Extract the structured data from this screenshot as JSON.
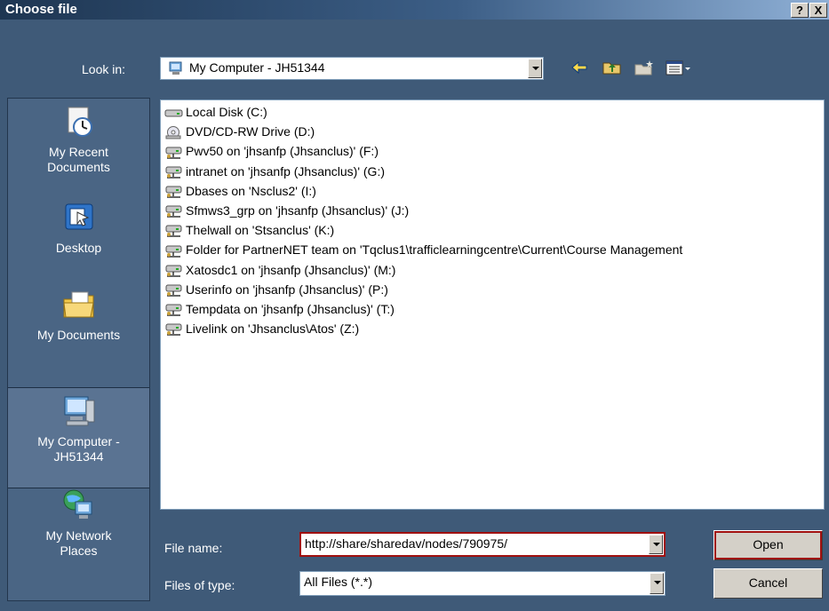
{
  "dialog": {
    "title": "Choose file",
    "help_label": "?",
    "close_label": "X"
  },
  "look_in": {
    "label": "Look in:",
    "value": "My Computer - JH51344"
  },
  "places": [
    {
      "label_line1": "My Recent",
      "label_line2": "Documents",
      "icon": "recent-documents-icon"
    },
    {
      "label_line1": "Desktop",
      "label_line2": "",
      "icon": "desktop-icon"
    },
    {
      "label_line1": "My Documents",
      "label_line2": "",
      "icon": "my-documents-icon"
    },
    {
      "label_line1": "My Computer -",
      "label_line2": "JH51344",
      "icon": "my-computer-icon"
    },
    {
      "label_line1": "My Network",
      "label_line2": "Places",
      "icon": "network-places-icon"
    }
  ],
  "files": [
    {
      "name": "Local Disk (C:)",
      "icon": "hard-disk-icon"
    },
    {
      "name": "DVD/CD-RW Drive (D:)",
      "icon": "dvd-drive-icon"
    },
    {
      "name": "Pwv50 on 'jhsanfp (Jhsanclus)' (F:)",
      "icon": "network-drive-icon"
    },
    {
      "name": "intranet on 'jhsanfp (Jhsanclus)' (G:)",
      "icon": "network-drive-icon"
    },
    {
      "name": "Dbases on 'Nsclus2' (I:)",
      "icon": "network-drive-icon"
    },
    {
      "name": "Sfmws3_grp on 'jhsanfp (Jhsanclus)' (J:)",
      "icon": "network-drive-icon"
    },
    {
      "name": "Thelwall on 'Stsanclus' (K:)",
      "icon": "network-drive-icon"
    },
    {
      "name": "Folder for PartnerNET team on 'Tqclus1\\trafficlearningcentre\\Current\\Course Management",
      "icon": "network-drive-icon"
    },
    {
      "name": "Xatosdc1 on 'jhsanfp (Jhsanclus)' (M:)",
      "icon": "network-drive-icon"
    },
    {
      "name": "Userinfo on 'jhsanfp (Jhsanclus)' (P:)",
      "icon": "network-drive-icon"
    },
    {
      "name": "Tempdata on 'jhsanfp (Jhsanclus)' (T:)",
      "icon": "network-drive-icon"
    },
    {
      "name": "Livelink on 'Jhsanclus\\Atos' (Z:)",
      "icon": "network-drive-icon"
    }
  ],
  "file_name": {
    "label": "File name:",
    "value": "http://share/sharedav/nodes/790975/"
  },
  "file_type": {
    "label": "Files of type:",
    "value": "All Files (*.*)"
  },
  "buttons": {
    "open": "Open",
    "cancel": "Cancel"
  },
  "toolbar": {
    "back_icon": "back-arrow-icon",
    "up_icon": "up-folder-icon",
    "new_folder_icon": "new-folder-icon",
    "view_icon": "view-menu-icon"
  }
}
